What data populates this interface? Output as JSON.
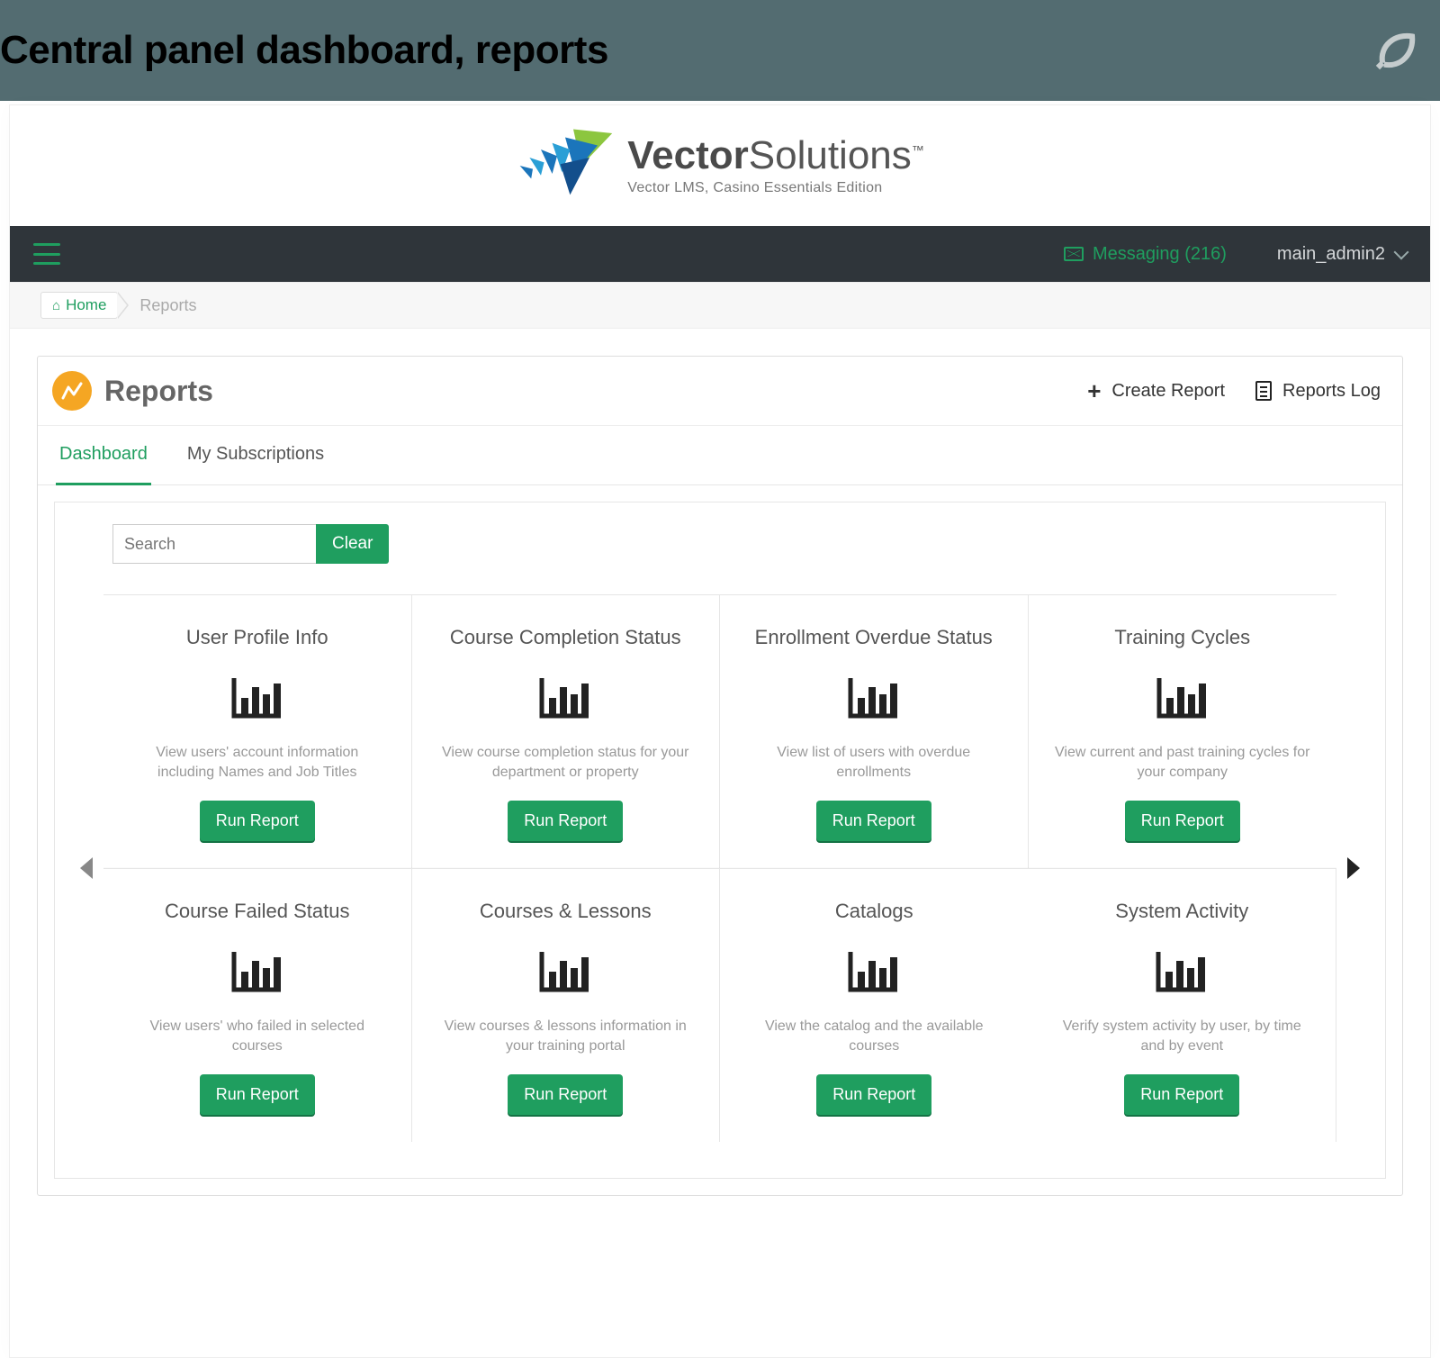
{
  "banner": {
    "title": "Central panel dashboard, reports"
  },
  "logo": {
    "brand_bold": "Vector",
    "brand_light": "Solutions",
    "tagline": "Vector LMS, Casino Essentials Edition"
  },
  "nav": {
    "messaging_label": "Messaging (216)",
    "user_label": "main_admin2"
  },
  "breadcrumb": {
    "home_label": "Home",
    "current": "Reports"
  },
  "card": {
    "title": "Reports",
    "create_label": "Create Report",
    "log_label": "Reports Log"
  },
  "tabs": {
    "dashboard": "Dashboard",
    "subscriptions": "My Subscriptions"
  },
  "search": {
    "placeholder": "Search",
    "clear_label": "Clear"
  },
  "run_label": "Run Report",
  "reports": [
    {
      "title": "User Profile Info",
      "desc": "View users' account information including Names and Job Titles"
    },
    {
      "title": "Course Completion Status",
      "desc": "View course completion status for your department or property"
    },
    {
      "title": "Enrollment Overdue Status",
      "desc": "View list of users with overdue enrollments"
    },
    {
      "title": "Training Cycles",
      "desc": "View current and past training cycles for your company"
    },
    {
      "title": "Course Failed Status",
      "desc": "View users' who failed in selected courses"
    },
    {
      "title": "Courses & Lessons",
      "desc": "View courses & lessons information in your training portal"
    },
    {
      "title": "Catalogs",
      "desc": "View the catalog and the available courses"
    },
    {
      "title": "System Activity",
      "desc": "Verify system activity by user, by time and by event"
    }
  ]
}
